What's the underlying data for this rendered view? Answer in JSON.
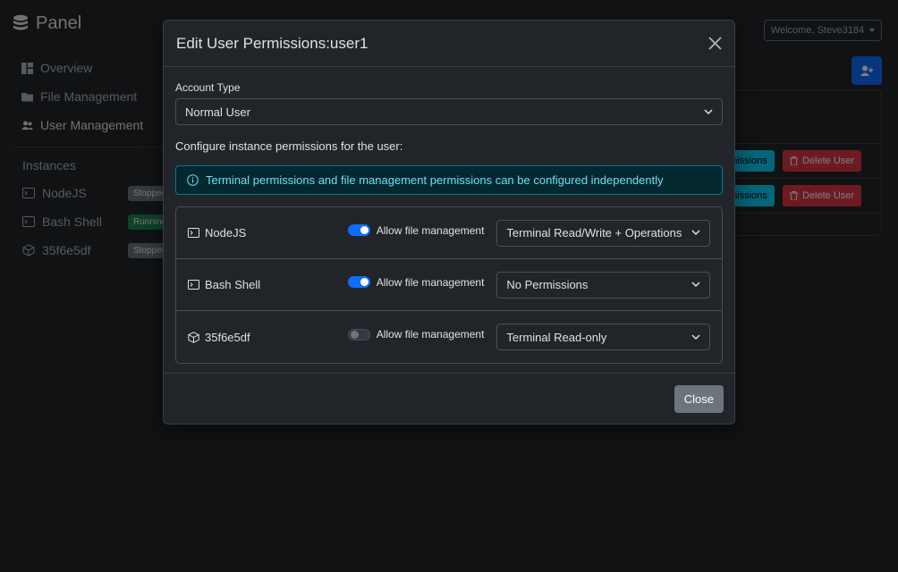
{
  "app": {
    "brand": "Panel",
    "nav": [
      {
        "label": "Overview"
      },
      {
        "label": "File Management"
      },
      {
        "label": "User Management"
      }
    ],
    "instances_title": "Instances",
    "instances": [
      {
        "name": "NodeJS",
        "status": "Stopped"
      },
      {
        "name": "Bash Shell",
        "status": "Running"
      },
      {
        "name": "35f6e5df",
        "status": "Stopped"
      }
    ],
    "welcome": "Welcome, Steve3184",
    "rows": [
      {
        "permissions_label": "Permissions",
        "delete_label": "Delete User"
      },
      {
        "permissions_label": "Permissions",
        "delete_label": "Delete User"
      }
    ]
  },
  "modal": {
    "title": "Edit User Permissions:user1",
    "account_type_label": "Account Type",
    "account_type_value": "Normal User",
    "configure_label": "Configure instance permissions for the user:",
    "alert_text": "Terminal permissions and file management permissions can be configured independently",
    "file_mgmt_label": "Allow file management",
    "permissions": [
      {
        "name": "NodeJS",
        "file_management": true,
        "terminal": "Terminal Read/Write + Operations"
      },
      {
        "name": "Bash Shell",
        "file_management": true,
        "terminal": "No Permissions"
      },
      {
        "name": "35f6e5df",
        "file_management": false,
        "terminal": "Terminal Read-only"
      }
    ],
    "close_label": "Close"
  }
}
